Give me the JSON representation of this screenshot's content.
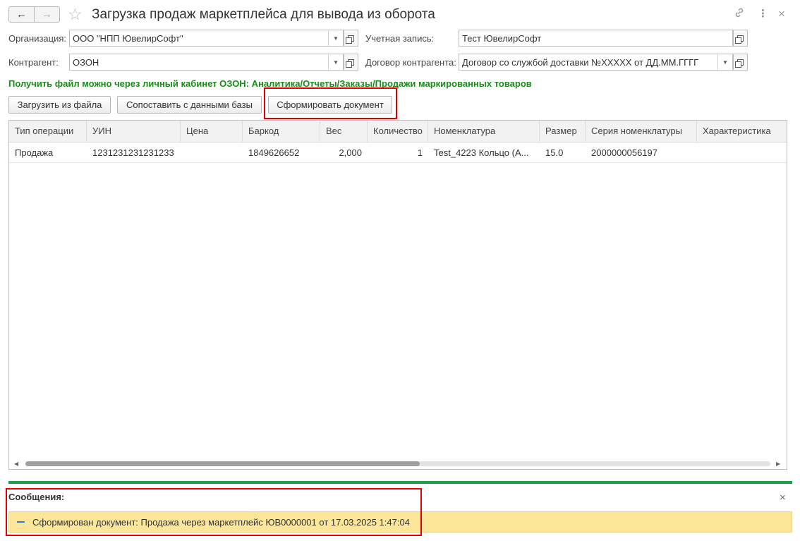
{
  "window": {
    "title": "Загрузка продаж маркетплейса для вывода из оборота",
    "back_icon": "←",
    "forward_icon": "→",
    "favorite_icon": "☆",
    "link_icon": "🔗",
    "more_icon": "⋮",
    "close_icon": "×"
  },
  "form": {
    "organization": {
      "label": "Организация:",
      "value": "ООО \"НПП ЮвелирСофт\""
    },
    "account": {
      "label": "Учетная запись:",
      "value": "Тест ЮвелирСофт"
    },
    "counterparty": {
      "label": "Контрагент:",
      "value": "ОЗОН"
    },
    "contract": {
      "label": "Договор контрагента:",
      "value": "Договор со службой доставки №XXXXX от ДД.ММ.ГГГГ"
    },
    "dropdown_glyph": "▼"
  },
  "hint": "Получить файл можно через личный кабинет ОЗОН: Аналитика/Отчеты/Заказы/Продажи маркированных товаров",
  "toolbar": {
    "load_file": "Загрузить из файла",
    "compare": "Сопоставить с данными базы",
    "create_doc": "Сформировать документ"
  },
  "table": {
    "columns": [
      "Тип операции",
      "УИН",
      "Цена",
      "Баркод",
      "Вес",
      "Количество",
      "Номенклатура",
      "Размер",
      "Серия номенклатуры",
      "Характеристика"
    ],
    "rows": [
      [
        "Продажа",
        "1231231231231233",
        "",
        "1849626652",
        "2,000",
        "1",
        "Test_4223 Кольцо (А...",
        "15.0",
        "2000000056197",
        ""
      ]
    ]
  },
  "scroll": {
    "left_arrow": "◀",
    "right_arrow": "▶"
  },
  "messages": {
    "title": "Сообщения:",
    "close": "×",
    "items": [
      "Сформирован документ: Продажа через маркетплейс ЮВ0000001 от 17.03.2025 1:47:04"
    ]
  }
}
